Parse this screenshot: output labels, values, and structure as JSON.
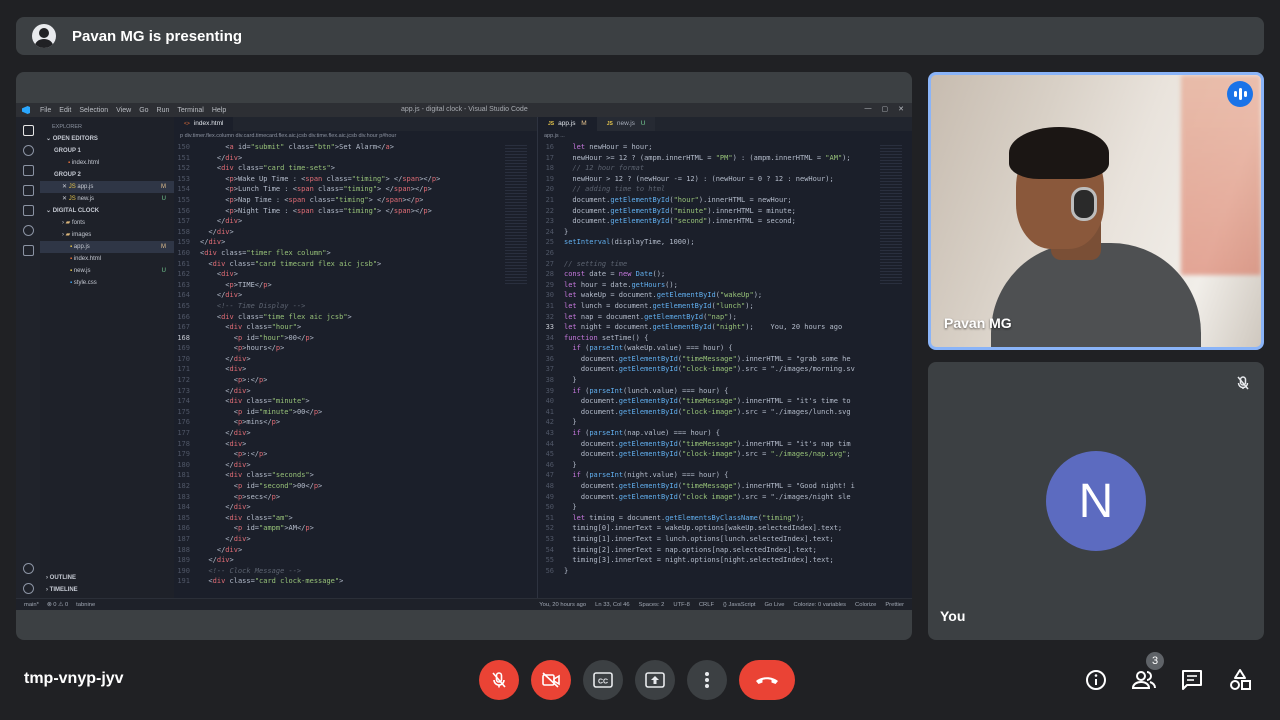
{
  "banner": {
    "text": "Pavan MG is presenting"
  },
  "vscode": {
    "menu": [
      "File",
      "Edit",
      "Selection",
      "View",
      "Go",
      "Run",
      "Terminal",
      "Help"
    ],
    "window_title": "app.js - digital clock - Visual Studio Code",
    "explorer": {
      "title": "EXPLORER",
      "open_editors": "OPEN EDITORS",
      "group1": "GROUP 1",
      "group1_file": "index.html",
      "group2": "GROUP 2",
      "group2_files": [
        {
          "name": "app.js",
          "badge": "M"
        },
        {
          "name": "new.js",
          "badge": "U"
        }
      ],
      "project": "DIGITAL CLOCK",
      "tree": [
        {
          "name": "fonts",
          "badge": ""
        },
        {
          "name": "images",
          "badge": ""
        },
        {
          "name": "app.js",
          "badge": "M"
        },
        {
          "name": "index.html",
          "badge": ""
        },
        {
          "name": "new.js",
          "badge": "U"
        },
        {
          "name": "style.css",
          "badge": ""
        }
      ],
      "outline": "OUTLINE",
      "timeline": "TIMELINE"
    },
    "left_tab": "index.html",
    "left_breadcrumb": "p  div.timer.flex.column  div.card.timecard.flex.aic.jcsb  div.time.flex.aic.jcsb  div.hour  p#hour",
    "right_tabs": [
      {
        "name": "app.js",
        "badge": "M"
      },
      {
        "name": "new.js",
        "badge": "U"
      }
    ],
    "right_breadcrumb": "app.js  ...",
    "status": {
      "left": [
        "main*",
        "⊗ 0 ⚠ 0",
        "tabnine"
      ],
      "right": [
        "You, 20 hours ago",
        "Ln 33, Col 46",
        "Spaces: 2",
        "UTF-8",
        "CRLF",
        "{} JavaScript",
        "Go Live",
        "Colorize: 0 variables",
        "Colorize",
        "Prettier"
      ]
    }
  },
  "left_code": [
    {
      "n": "150",
      "t": "      <a id=\"submit\" class=\"btn\">Set Alarm</a>"
    },
    {
      "n": "151",
      "t": "    </div>"
    },
    {
      "n": "152",
      "t": "    <div class=\"card time-sets\">"
    },
    {
      "n": "153",
      "t": "      <p>Wake Up Time : <span class=\"timing\"> </span></p>"
    },
    {
      "n": "154",
      "t": "      <p>Lunch Time : <span class=\"timing\"> </span></p>"
    },
    {
      "n": "155",
      "t": "      <p>Nap Time : <span class=\"timing\"> </span></p>"
    },
    {
      "n": "156",
      "t": "      <p>Night Time : <span class=\"timing\"> </span></p>"
    },
    {
      "n": "157",
      "t": "    </div>"
    },
    {
      "n": "158",
      "t": "  </div>"
    },
    {
      "n": "159",
      "t": "</div>"
    },
    {
      "n": "160",
      "t": "<div class=\"timer flex column\">"
    },
    {
      "n": "161",
      "t": "  <div class=\"card timecard flex aic jcsb\">"
    },
    {
      "n": "162",
      "t": "    <div>"
    },
    {
      "n": "163",
      "t": "      <p>TIME</p>"
    },
    {
      "n": "164",
      "t": "    </div>"
    },
    {
      "n": "165",
      "t": "    <!-- Time Display -->"
    },
    {
      "n": "166",
      "t": "    <div class=\"time flex aic jcsb\">"
    },
    {
      "n": "167",
      "t": "      <div class=\"hour\">"
    },
    {
      "n": "168",
      "t": "        <p id=\"hour\">00</p>",
      "cur": true
    },
    {
      "n": "169",
      "t": "        <p>hours</p>"
    },
    {
      "n": "170",
      "t": "      </div>"
    },
    {
      "n": "171",
      "t": "      <div>"
    },
    {
      "n": "172",
      "t": "        <p>:</p>"
    },
    {
      "n": "173",
      "t": "      </div>"
    },
    {
      "n": "174",
      "t": "      <div class=\"minute\">"
    },
    {
      "n": "175",
      "t": "        <p id=\"minute\">00</p>"
    },
    {
      "n": "176",
      "t": "        <p>mins</p>"
    },
    {
      "n": "177",
      "t": "      </div>"
    },
    {
      "n": "178",
      "t": "      <div>"
    },
    {
      "n": "179",
      "t": "        <p>:</p>"
    },
    {
      "n": "180",
      "t": "      </div>"
    },
    {
      "n": "181",
      "t": "      <div class=\"seconds\">"
    },
    {
      "n": "182",
      "t": "        <p id=\"second\">00</p>"
    },
    {
      "n": "183",
      "t": "        <p>secs</p>"
    },
    {
      "n": "184",
      "t": "      </div>"
    },
    {
      "n": "185",
      "t": "      <div class=\"am\">"
    },
    {
      "n": "186",
      "t": "        <p id=\"ampm\">AM</p>"
    },
    {
      "n": "187",
      "t": "      </div>"
    },
    {
      "n": "188",
      "t": "    </div>"
    },
    {
      "n": "189",
      "t": "  </div>"
    },
    {
      "n": "190",
      "t": "  <!-- Clock Message -->"
    },
    {
      "n": "191",
      "t": "  <div class=\"card clock-message\">"
    }
  ],
  "right_code": [
    {
      "n": "16",
      "t": "  let newHour = hour;"
    },
    {
      "n": "17",
      "t": "  newHour >= 12 ? (ampm.innerHTML = \"PM\") : (ampm.innerHTML = \"AM\");"
    },
    {
      "n": "18",
      "t": "  // 12 hour format"
    },
    {
      "n": "19",
      "t": "  newHour > 12 ? (newHour -= 12) : (newHour = 0 ? 12 : newHour);"
    },
    {
      "n": "20",
      "t": "  // adding time to html"
    },
    {
      "n": "21",
      "t": "  document.getElementById(\"hour\").innerHTML = newHour;"
    },
    {
      "n": "22",
      "t": "  document.getElementById(\"minute\").innerHTML = minute;"
    },
    {
      "n": "23",
      "t": "  document.getElementById(\"second\").innerHTML = second;"
    },
    {
      "n": "24",
      "t": "}"
    },
    {
      "n": "25",
      "t": "setInterval(displayTime, 1000);"
    },
    {
      "n": "26",
      "t": ""
    },
    {
      "n": "27",
      "t": "// setting time"
    },
    {
      "n": "28",
      "t": "const date = new Date();"
    },
    {
      "n": "29",
      "t": "let hour = date.getHours();"
    },
    {
      "n": "30",
      "t": "let wakeUp = document.getElementById(\"wakeUp\");"
    },
    {
      "n": "31",
      "t": "let lunch = document.getElementById(\"lunch\");"
    },
    {
      "n": "32",
      "t": "let nap = document.getElementById(\"nap\");"
    },
    {
      "n": "33",
      "t": "let night = document.getElementById(\"night\");    You, 20 hours ago",
      "cur": true
    },
    {
      "n": "34",
      "t": "function setTime() {"
    },
    {
      "n": "35",
      "t": "  if (parseInt(wakeUp.value) === hour) {"
    },
    {
      "n": "36",
      "t": "    document.getElementById(\"timeMessage\").innerHTML = \"grab some he"
    },
    {
      "n": "37",
      "t": "    document.getElementById(\"clock-image\").src = \"./images/morning.sv"
    },
    {
      "n": "38",
      "t": "  }"
    },
    {
      "n": "39",
      "t": "  if (parseInt(lunch.value) === hour) {"
    },
    {
      "n": "40",
      "t": "    document.getElementById(\"timeMessage\").innerHTML = \"it's time to"
    },
    {
      "n": "41",
      "t": "    document.getElementById(\"clock-image\").src = \"./images/lunch.svg"
    },
    {
      "n": "42",
      "t": "  }"
    },
    {
      "n": "43",
      "t": "  if (parseInt(nap.value) === hour) {"
    },
    {
      "n": "44",
      "t": "    document.getElementById(\"timeMessage\").innerHTML = \"it's nap tim"
    },
    {
      "n": "45",
      "t": "    document.getElementById(\"clock-image\").src = \"./images/nap.svg\";"
    },
    {
      "n": "46",
      "t": "  }"
    },
    {
      "n": "47",
      "t": "  if (parseInt(night.value) === hour) {"
    },
    {
      "n": "48",
      "t": "    document.getElementById(\"timeMessage\").innerHTML = \"Good night! i"
    },
    {
      "n": "49",
      "t": "    document.getElementById(\"clock image\").src = \"./images/night sle"
    },
    {
      "n": "50",
      "t": "  }"
    },
    {
      "n": "51",
      "t": "  let timing = document.getElementsByClassName(\"timing\");"
    },
    {
      "n": "52",
      "t": "  timing[0].innerText = wakeUp.options[wakeUp.selectedIndex].text;"
    },
    {
      "n": "53",
      "t": "  timing[1].innerText = lunch.options[lunch.selectedIndex].text;"
    },
    {
      "n": "54",
      "t": "  timing[2].innerText = nap.options[nap.selectedIndex].text;"
    },
    {
      "n": "55",
      "t": "  timing[3].innerText = night.options[night.selectedIndex].text;"
    },
    {
      "n": "56",
      "t": "}"
    }
  ],
  "pavan_tile": {
    "name": "Pavan MG"
  },
  "you_tile": {
    "name": "You",
    "initial": "N"
  },
  "meeting_code": "tmp-vnyp-jyv",
  "participants_count": "3",
  "colors": {
    "accent": "#8ab4f8",
    "danger": "#ea4335",
    "surface": "#3c4043",
    "background": "#202124",
    "avatar": "#5c6bc0"
  }
}
